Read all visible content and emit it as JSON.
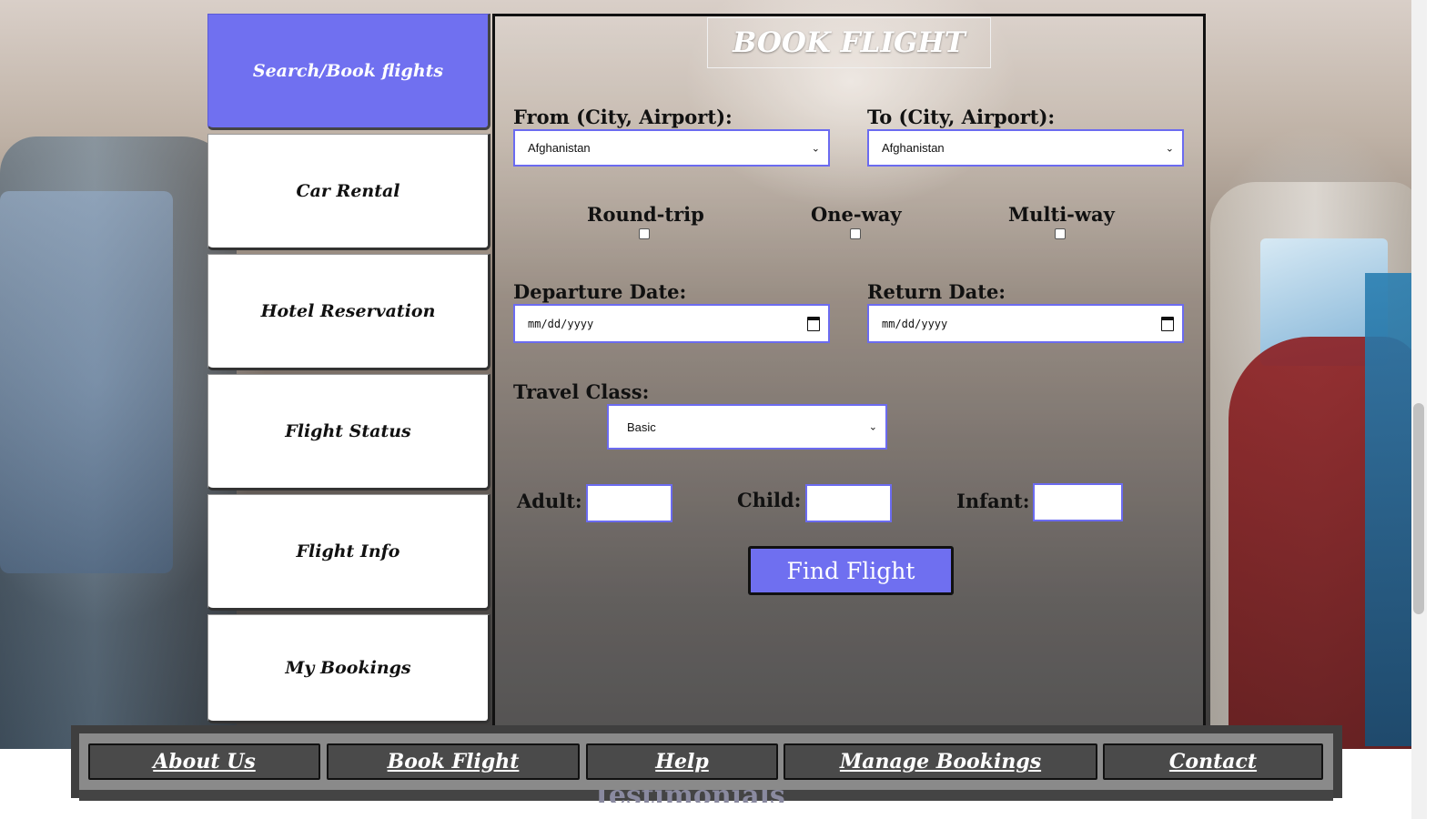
{
  "sidebar": {
    "items": [
      {
        "label": "Search/Book flights",
        "active": true
      },
      {
        "label": "Car Rental"
      },
      {
        "label": "Hotel Reservation"
      },
      {
        "label": "Flight Status"
      },
      {
        "label": "Flight Info"
      },
      {
        "label": "My Bookings"
      }
    ]
  },
  "booking": {
    "title": "BOOK FLIGHT",
    "from_label": "From (City, Airport):",
    "from_value": "Afghanistan",
    "to_label": "To (City, Airport):",
    "to_value": "Afghanistan",
    "trip_types": [
      "Round-trip",
      "One-way",
      "Multi-way"
    ],
    "departure_label": "Departure Date:",
    "departure_placeholder": "mm/dd/yyyy",
    "return_label": "Return Date:",
    "return_placeholder": "mm/dd/yyyy",
    "class_label": "Travel Class:",
    "class_value": "Basic",
    "adult_label": "Adult:",
    "child_label": "Child:",
    "infant_label": "Infant:",
    "find_button": "Find Flight"
  },
  "footer": {
    "links": [
      "About Us",
      "Book Flight",
      "Help",
      "Manage Bookings",
      "Contact"
    ]
  },
  "below": {
    "partial_heading": "Testimonials"
  },
  "colors": {
    "accent": "#7070f0",
    "footer_bg": "#3f3f3f",
    "footer_button": "#4a4a4a"
  },
  "icons": {
    "select_arrow": "chevron-down-icon",
    "date_picker": "calendar-icon"
  }
}
